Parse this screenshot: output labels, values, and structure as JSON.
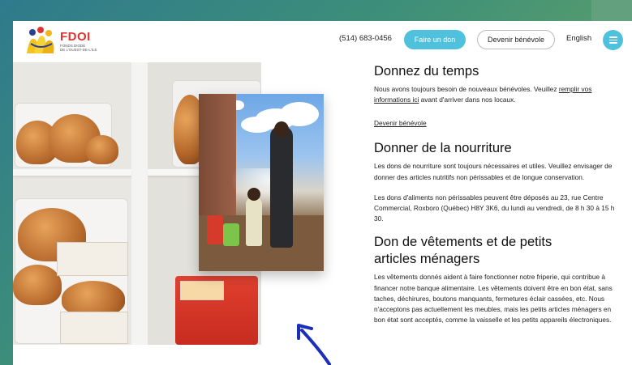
{
  "header": {
    "logo_title": "FDOI",
    "logo_sub_line1": "FONDS DIODE",
    "logo_sub_line2": "DE L'OUEST-DE-L'ILE",
    "phone": "(514) 683-0456",
    "donate_label": "Faire un don",
    "volunteer_label": "Devenir bénévole",
    "language_label": "English",
    "menu_icon": "hamburger-menu-icon"
  },
  "sections": {
    "time": {
      "title": "Donnez du temps",
      "text_before_link": "Nous avons toujours besoin de nouveaux bénévoles. Veuillez ",
      "inline_link": "remplir vos informations ici",
      "text_after_link": " avant d'arriver dans nos locaux.",
      "cta_link": "Devenir bénévole"
    },
    "food": {
      "title": "Donner de la nourriture",
      "paragraph1": "Les dons de nourriture sont toujours nécessaires et utiles. Veuillez envisager de donner des articles nutritifs non périssables et de longue conservation.",
      "paragraph2": "Les dons d'aliments non périssables peuvent être déposés au 23, rue Centre Commercial, Roxboro (Québec) H8Y 3K6, du lundi au vendredi, de 8 h 30 à 15 h 30."
    },
    "clothing": {
      "title": "Don de vêtements et de petits articles ménagers",
      "paragraph": "Les vêtements donnés aident à faire fonctionner notre friperie, qui contribue à financer notre banque alimentaire. Les vêtements doivent être en bon état, sans taches, déchirures, boutons manquants, fermetures éclair cassées, etc. Nous n'acceptons pas actuellement les meubles, mais les petits articles ménagers en bon état sont acceptés, comme la vaisselle et les petits appareils électroniques."
    }
  },
  "colors": {
    "accent": "#4fc1dc",
    "brand_red": "#e0322f",
    "arrow": "#1b2fb8"
  }
}
